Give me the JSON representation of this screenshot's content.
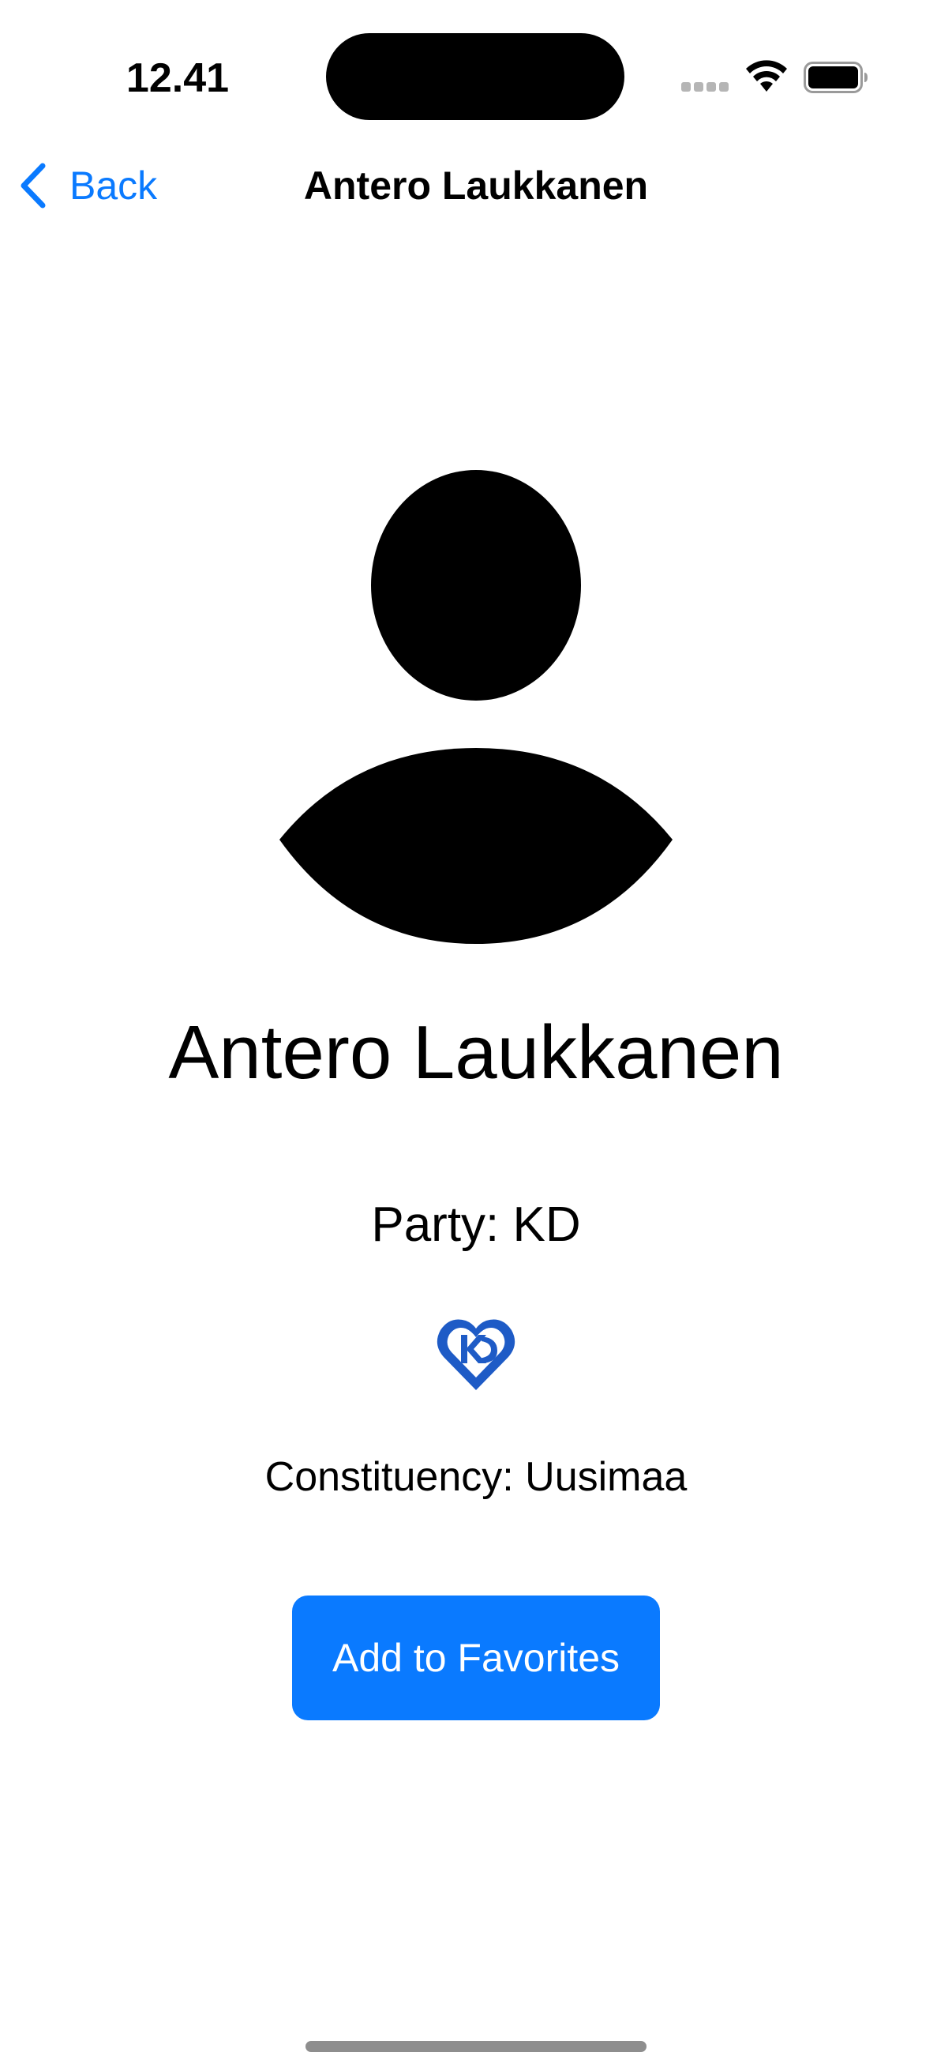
{
  "status_bar": {
    "time": "12.41",
    "icons": [
      "cellular-signal-icon",
      "wifi-icon",
      "battery-icon"
    ]
  },
  "nav": {
    "back_label": "Back",
    "title": "Antero Laukkanen"
  },
  "profile": {
    "avatar_icon": "person-silhouette-icon",
    "name": "Antero Laukkanen",
    "party": "Party: KD",
    "party_logo_icon": "kd-heart-logo",
    "constituency": "Constituency: Uusimaa"
  },
  "actions": {
    "favorite_label": "Add to Favorites"
  },
  "colors": {
    "accent": "#0a7aff",
    "button_text": "#ffffff",
    "party_logo": "#1e5bc6"
  }
}
